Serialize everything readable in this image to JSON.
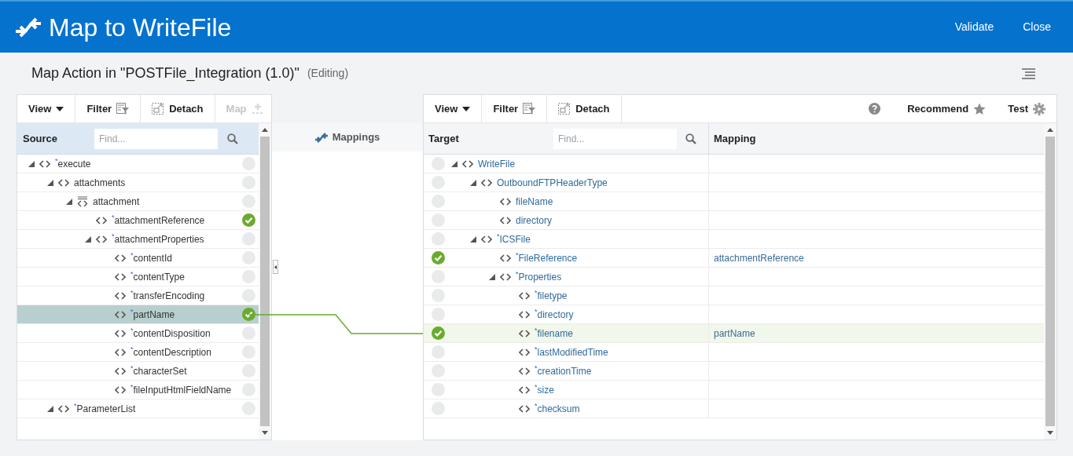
{
  "header": {
    "title": "Map to WriteFile",
    "actions": [
      "Validate",
      "Close"
    ]
  },
  "subheader": {
    "title": "Map Action in \"POSTFile_Integration (1.0)\"",
    "status": "(Editing)"
  },
  "source": {
    "toolbar": [
      {
        "kind": "view",
        "label": "View",
        "disabled": false
      },
      {
        "kind": "filter",
        "label": "Filter",
        "disabled": false
      },
      {
        "kind": "detach",
        "label": "Detach",
        "disabled": false
      },
      {
        "kind": "map",
        "label": "Map",
        "disabled": true
      }
    ],
    "heading": "Source",
    "search": {
      "placeholder": "Find..."
    },
    "tree": [
      {
        "name": "$^{*}$execute",
        "kind": "element",
        "expanded": true,
        "mapped": false,
        "selected": false,
        "children": [
          {
            "name": "attachments",
            "kind": "element",
            "expanded": true,
            "mapped": false,
            "selected": false,
            "children": [
              {
                "name": "attachment",
                "kind": "repeating",
                "expanded": true,
                "mapped": false,
                "selected": false,
                "children": [
                  {
                    "name": "$^{*}$attachmentReference",
                    "kind": "element",
                    "mapped": true,
                    "selected": false
                  },
                  {
                    "name": "$^{*}$attachmentProperties",
                    "kind": "element",
                    "expanded": true,
                    "mapped": false,
                    "selected": false,
                    "children": [
                      {
                        "name": "$^{*}$contentId",
                        "kind": "element",
                        "mapped": false,
                        "selected": false
                      },
                      {
                        "name": "$^{*}$contentType",
                        "kind": "element",
                        "mapped": false,
                        "selected": false
                      },
                      {
                        "name": "$^{*}$transferEncoding",
                        "kind": "element",
                        "mapped": false,
                        "selected": false
                      },
                      {
                        "name": "$^{*}$partName",
                        "kind": "element",
                        "mapped": true,
                        "selected": true
                      },
                      {
                        "name": "$^{*}$contentDisposition",
                        "kind": "element",
                        "mapped": false,
                        "selected": false
                      },
                      {
                        "name": "$^{*}$contentDescription",
                        "kind": "element",
                        "mapped": false,
                        "selected": false
                      },
                      {
                        "name": "$^{*}$characterSet",
                        "kind": "element",
                        "mapped": false,
                        "selected": false
                      },
                      {
                        "name": "$^{*}$fileInputHtmlFieldName",
                        "kind": "element",
                        "mapped": false,
                        "selected": false
                      }
                    ]
                  }
                ]
              }
            ]
          },
          {
            "name": "$^{*}$ParameterList",
            "kind": "element",
            "expanded": true,
            "mapped": false,
            "selected": false
          }
        ]
      }
    ]
  },
  "middle": {
    "heading": "Mappings"
  },
  "target": {
    "toolbar": [
      {
        "kind": "view",
        "label": "View",
        "disabled": false
      },
      {
        "kind": "filter",
        "label": "Filter",
        "disabled": false
      },
      {
        "kind": "detach",
        "label": "Detach",
        "disabled": false
      },
      {
        "kind": "help",
        "disabled": false
      },
      {
        "kind": "recommend",
        "label": "Recommend",
        "disabled": false
      },
      {
        "kind": "test",
        "label": "Test",
        "disabled": false
      }
    ],
    "heading": "Target",
    "search": {
      "placeholder": "Find..."
    },
    "mapping_heading": "Mapping",
    "tree": [
      {
        "name": "WriteFile",
        "kind": "element",
        "expanded": true,
        "mapped": false,
        "selected": false,
        "children": [
          {
            "name": "OutboundFTPHeaderType",
            "kind": "element",
            "expanded": true,
            "mapped": false,
            "selected": false,
            "children": [
              {
                "name": "fileName",
                "kind": "element",
                "mapped": false,
                "selected": false
              },
              {
                "name": "directory",
                "kind": "element",
                "mapped": false,
                "selected": false
              }
            ]
          },
          {
            "name": "$^{*}$ICSFile",
            "kind": "element",
            "expanded": true,
            "mapped": false,
            "selected": false,
            "children": [
              {
                "name": "$^{*}$FileReference",
                "kind": "element",
                "mapped": true,
                "selected": false,
                "mapping": "attachmentReference"
              },
              {
                "name": "$^{*}$Properties",
                "kind": "element",
                "expanded": true,
                "mapped": false,
                "selected": false,
                "children": [
                  {
                    "name": "$^{*}$filetype",
                    "kind": "element",
                    "mapped": false,
                    "selected": false
                  },
                  {
                    "name": "$^{*}$directory",
                    "kind": "element",
                    "mapped": false,
                    "selected": false
                  },
                  {
                    "name": "$^{*}$filename",
                    "kind": "element",
                    "mapped": true,
                    "selected": true,
                    "mapping": "partName"
                  },
                  {
                    "name": "$^{*}$lastModifiedTime",
                    "kind": "element",
                    "mapped": false,
                    "selected": false
                  },
                  {
                    "name": "$^{*}$creationTime",
                    "kind": "element",
                    "mapped": false,
                    "selected": false
                  },
                  {
                    "name": "$^{*}$size",
                    "kind": "element",
                    "mapped": false,
                    "selected": false
                  },
                  {
                    "name": "$^{*}$checksum",
                    "kind": "element",
                    "mapped": false,
                    "selected": false
                  }
                ]
              }
            ]
          }
        ]
      }
    ]
  }
}
